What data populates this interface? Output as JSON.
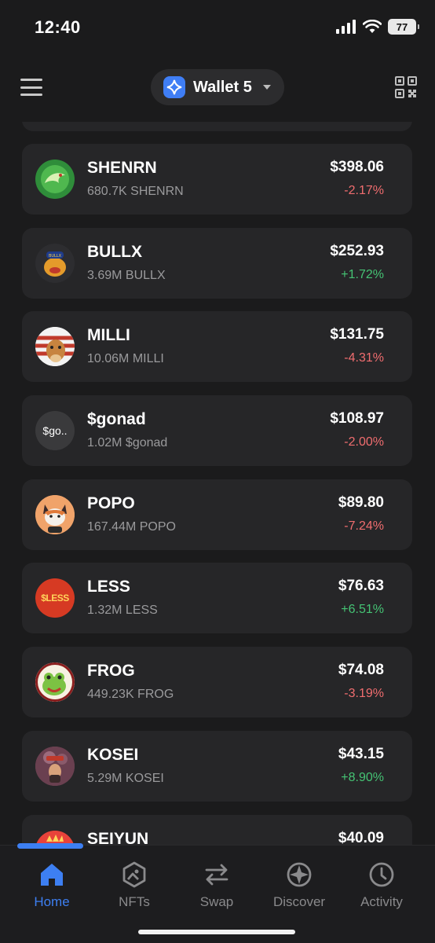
{
  "status_bar": {
    "time": "12:40",
    "battery": "77"
  },
  "header": {
    "wallet_name": "Wallet 5"
  },
  "tokens": [
    {
      "name": "SHENRN",
      "balance": "680.7K SHENRN",
      "value": "$398.06",
      "change": "-2.17%",
      "direction": "down",
      "avatar_color": "#2f8d3a",
      "avatar_icon": "dragon-avatar"
    },
    {
      "name": "BULLX",
      "balance": "3.69M BULLX",
      "value": "$252.93",
      "change": "+1.72%",
      "direction": "up",
      "avatar_color": "#e49b2b",
      "avatar_icon": "bull-avatar"
    },
    {
      "name": "MILLI",
      "balance": "10.06M MILLI",
      "value": "$131.75",
      "change": "-4.31%",
      "direction": "down",
      "avatar_color": "#c7a06a",
      "avatar_icon": "dog-avatar"
    },
    {
      "name": "$gonad",
      "balance": "1.02M $gonad",
      "value": "$108.97",
      "change": "-2.00%",
      "direction": "down",
      "avatar_color": "#3a3a3c",
      "avatar_icon": "text-avatar",
      "avatar_text": "$go.."
    },
    {
      "name": "POPO",
      "balance": "167.44M POPO",
      "value": "$89.80",
      "change": "-7.24%",
      "direction": "down",
      "avatar_color": "#f0a36a",
      "avatar_icon": "fox-avatar"
    },
    {
      "name": "LESS",
      "balance": "1.32M LESS",
      "value": "$76.63",
      "change": "+6.51%",
      "direction": "up",
      "avatar_color": "#d63a23",
      "avatar_icon": "less-logo-avatar",
      "avatar_text": "$LESS"
    },
    {
      "name": "FROG",
      "balance": "449.23K FROG",
      "value": "$74.08",
      "change": "-3.19%",
      "direction": "down",
      "avatar_color": "#7cc243",
      "avatar_icon": "frog-avatar"
    },
    {
      "name": "KOSEI",
      "balance": "5.29M KOSEI",
      "value": "$43.15",
      "change": "+8.90%",
      "direction": "up",
      "avatar_color": "#7d4b5c",
      "avatar_icon": "character-avatar"
    },
    {
      "name": "SEIYUN",
      "balance": "",
      "value": "$40.09",
      "change": "",
      "direction": "",
      "avatar_color": "#e8423a",
      "avatar_icon": "seiyun-avatar"
    }
  ],
  "nav": {
    "home": "Home",
    "nfts": "NFTs",
    "swap": "Swap",
    "discover": "Discover",
    "activity": "Activity",
    "active": "home",
    "active_color": "#3d7ff2"
  }
}
